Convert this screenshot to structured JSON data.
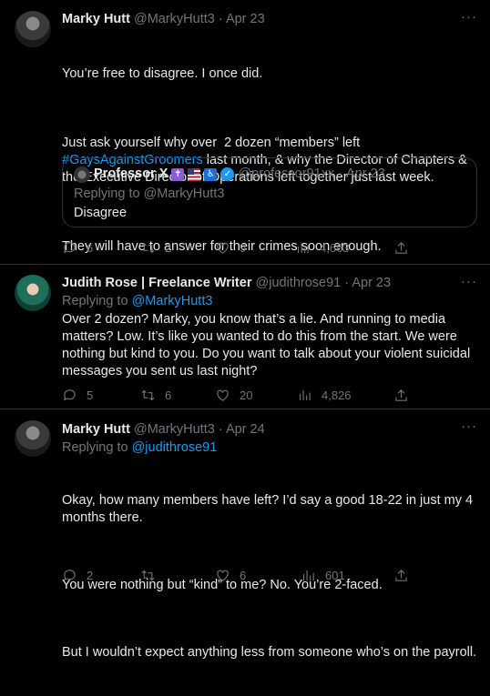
{
  "tweets": [
    {
      "name": "Marky Hutt",
      "handle": "@MarkyHutt3",
      "dot": "·",
      "date": "Apr 23",
      "more": "···",
      "text_p1": "You’re free to disagree. I once did.",
      "text_p2a": "Just ask yourself why over  2 dozen “members” left",
      "hashtag": "#GaysAgainstGroomers",
      "text_p2b": " last month, & why the Director of Chapters & the Executive Director of Operations left together just last week.",
      "text_p3": "They will have to answer for their crimes soon enough.",
      "quote": {
        "name": "Professor X",
        "emoji_cross": "✝",
        "emoji_flag": "🇺🇸",
        "emoji_access": "♿",
        "handle": "@professor91xx",
        "dot": "·",
        "date": "Apr 23",
        "replying": "Replying to @MarkyHutt3",
        "text": "Disagree"
      },
      "replies": "6",
      "retweets": "2",
      "likes": "9",
      "views": "4,663"
    },
    {
      "name": "Judith Rose | Freelance Writer",
      "handle": "@judithrose91",
      "dot": "·",
      "date": "Apr 23",
      "more": "···",
      "replying_label": "Replying to ",
      "replying_handle": "@MarkyHutt3",
      "text": "Over 2 dozen? Marky, you know that’s a lie. And running to media matters? Low. It’s like you wanted to do this from the start. We were nothing but kind to you. Do you want to talk about your violent suicidal messages you sent us last night?",
      "replies": "5",
      "retweets": "6",
      "likes": "20",
      "views": "4,826"
    },
    {
      "name": "Marky Hutt",
      "handle": "@MarkyHutt3",
      "dot": "·",
      "date": "Apr 24",
      "more": "···",
      "replying_label": "Replying to ",
      "replying_handle": "@judithrose91",
      "text_p1": "Okay, how many members have left? I’d say a good 18-22 in just my 4 months there.",
      "text_p2": "You were nothing but “kind” to me? No. You’re 2-faced.",
      "text_p3": "But I wouldn’t expect anything less from someone who’s on the payroll.",
      "replies": "2",
      "retweets": "",
      "likes": "6",
      "views": "601"
    }
  ],
  "colors": {
    "background": "#000000",
    "text": "#e7e9ea",
    "muted": "#71767b",
    "link": "#1d9bf0",
    "border": "#2f3336"
  }
}
